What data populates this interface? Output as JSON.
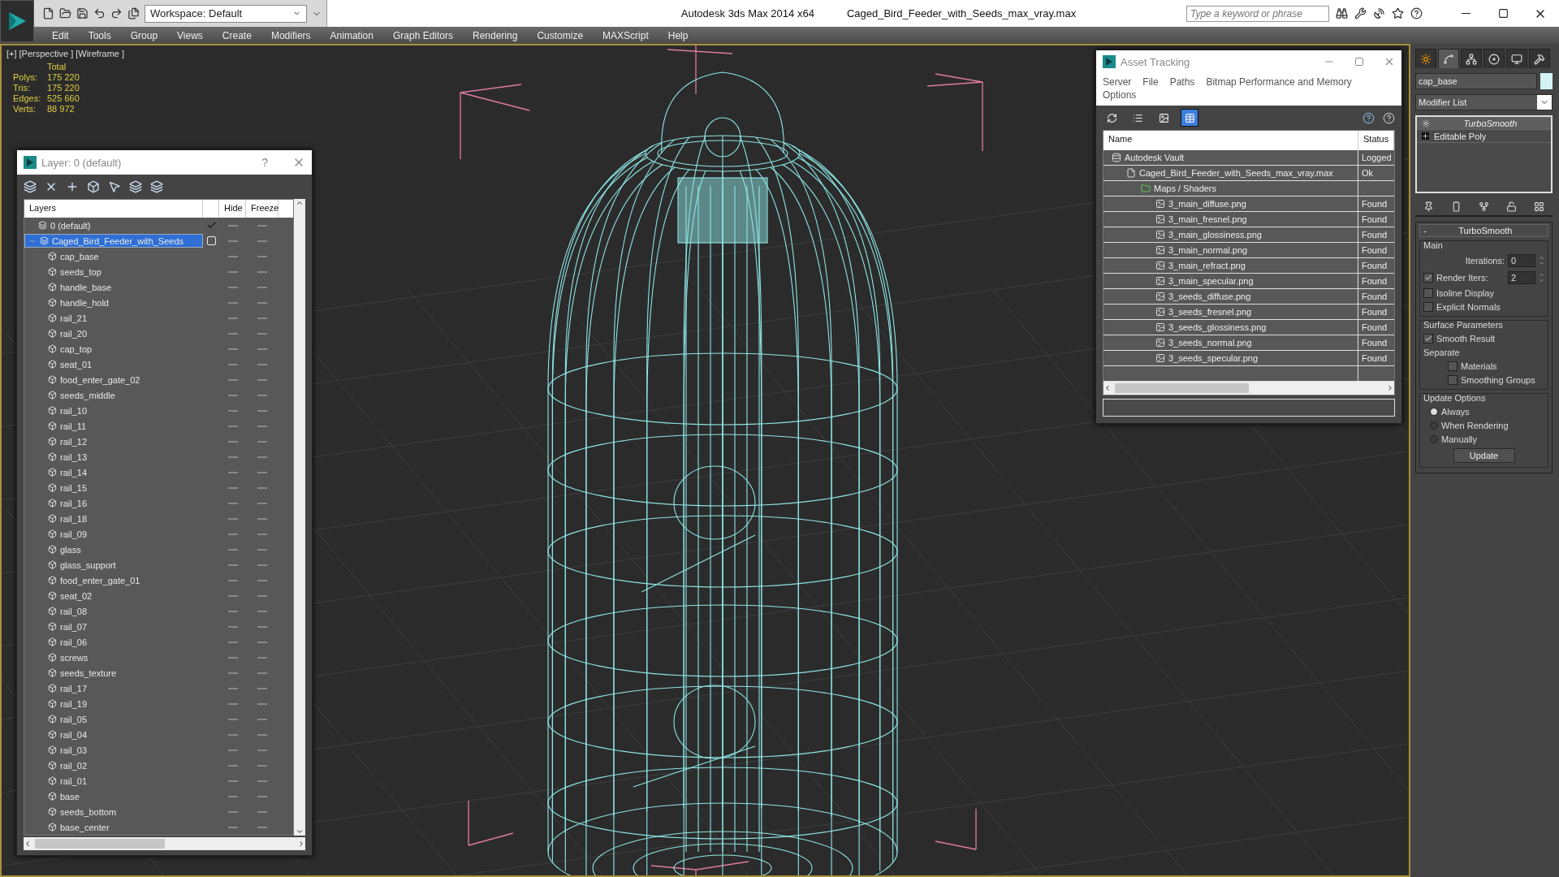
{
  "window": {
    "app_title": "Autodesk 3ds Max  2014 x64",
    "file_title": "Caged_Bird_Feeder_with_Seeds_max_vray.max",
    "workspace": "Workspace: Default",
    "search": {
      "placeholder": "Type a keyword or phrase"
    }
  },
  "menu": [
    "Edit",
    "Tools",
    "Group",
    "Views",
    "Create",
    "Modifiers",
    "Animation",
    "Graph Editors",
    "Rendering",
    "Customize",
    "MAXScript",
    "Help"
  ],
  "viewport": {
    "labels": [
      "[+]",
      "[Perspective ]",
      "[Wireframe ]"
    ],
    "stats": {
      "heading": "Total",
      "rows": [
        {
          "label": "Polys:",
          "value": "175 220"
        },
        {
          "label": "Tris:",
          "value": "175 220"
        },
        {
          "label": "Edges:",
          "value": "525 660"
        },
        {
          "label": "Verts:",
          "value": "88 972"
        }
      ]
    }
  },
  "layer_window": {
    "title": "Layer: 0 (default)",
    "help": "?",
    "columns": [
      "Layers",
      "Hide",
      "Freeze"
    ],
    "layers": [
      {
        "name": "0 (default)",
        "selected": false,
        "current": true
      },
      {
        "name": "Caged_Bird_Feeder_with_Seeds",
        "selected": true,
        "current": false,
        "children": [
          "cap_base",
          "seeds_top",
          "handle_base",
          "handle_hold",
          "rail_21",
          "rail_20",
          "cap_top",
          "seat_01",
          "food_enter_gate_02",
          "seeds_middle",
          "rail_10",
          "rail_11",
          "rail_12",
          "rail_13",
          "rail_14",
          "rail_15",
          "rail_16",
          "rail_18",
          "rail_09",
          "glass",
          "glass_support",
          "food_enter_gate_01",
          "seat_02",
          "rail_08",
          "rail_07",
          "rail_06",
          "screws",
          "seeds_texture",
          "rail_17",
          "rail_19",
          "rail_05",
          "rail_04",
          "rail_03",
          "rail_02",
          "rail_01",
          "base",
          "seeds_bottom",
          "base_center"
        ]
      }
    ]
  },
  "asset_window": {
    "title": "Asset Tracking",
    "menu": [
      "Server",
      "File",
      "Paths",
      "Bitmap Performance and Memory",
      "Options"
    ],
    "view_buttons": [
      {
        "selected": false
      },
      {
        "selected": false
      },
      {
        "selected": false
      },
      {
        "selected": true
      }
    ],
    "columns": [
      "Name",
      "Status"
    ],
    "tree": [
      {
        "kind": "vault",
        "name": "Autodesk Vault",
        "status": "Logged",
        "children": [
          {
            "kind": "file",
            "name": "Caged_Bird_Feeder_with_Seeds_max_vray.max",
            "status": "Ok",
            "children": [
              {
                "kind": "folder",
                "name": "Maps / Shaders",
                "children": [
                  {
                    "kind": "image",
                    "name": "3_main_diffuse.png",
                    "status": "Found"
                  },
                  {
                    "kind": "image",
                    "name": "3_main_fresnel.png",
                    "status": "Found"
                  },
                  {
                    "kind": "image",
                    "name": "3_main_glossiness.png",
                    "status": "Found"
                  },
                  {
                    "kind": "image",
                    "name": "3_main_normal.png",
                    "status": "Found"
                  },
                  {
                    "kind": "image",
                    "name": "3_main_refract.png",
                    "status": "Found"
                  },
                  {
                    "kind": "image",
                    "name": "3_main_specular.png",
                    "status": "Found"
                  },
                  {
                    "kind": "image",
                    "name": "3_seeds_diffuse.png",
                    "status": "Found"
                  },
                  {
                    "kind": "image",
                    "name": "3_seeds_fresnel.png",
                    "status": "Found"
                  },
                  {
                    "kind": "image",
                    "name": "3_seeds_glossiness.png",
                    "status": "Found"
                  },
                  {
                    "kind": "image",
                    "name": "3_seeds_normal.png",
                    "status": "Found"
                  },
                  {
                    "kind": "image",
                    "name": "3_seeds_specular.png",
                    "status": "Found"
                  }
                ]
              }
            ]
          }
        ]
      }
    ]
  },
  "command_panel": {
    "tabs": [
      {
        "selected": false
      },
      {
        "selected": true
      },
      {
        "selected": false
      },
      {
        "selected": false
      },
      {
        "selected": false
      },
      {
        "selected": false
      }
    ],
    "object_name": "cap_base",
    "modifier_list": "Modifier List",
    "stack": [
      {
        "name": "TurboSmooth",
        "selected": true,
        "kind": "modifier"
      },
      {
        "name": "Editable Poly",
        "selected": false,
        "kind": "object"
      }
    ],
    "rollout": {
      "title": "TurboSmooth",
      "collapse": "-",
      "main": {
        "title": "Main",
        "iterations": {
          "label": "Iterations:",
          "value": "0"
        },
        "render_iters": {
          "label": "Render Iters:",
          "value": "2",
          "checked": true
        },
        "checks": [
          {
            "label": "Isoline Display",
            "checked": false
          },
          {
            "label": "Explicit Normals",
            "checked": false
          }
        ]
      },
      "surface": {
        "title": "Surface Parameters",
        "smooth_result": {
          "label": "Smooth Result",
          "checked": true
        },
        "separate": "Separate",
        "checks": [
          {
            "label": "Materials",
            "checked": false
          },
          {
            "label": "Smoothing Groups",
            "checked": false
          }
        ]
      },
      "update": {
        "title": "Update Options",
        "options": [
          {
            "label": "Always",
            "selected": true
          },
          {
            "label": "When Rendering",
            "selected": false
          },
          {
            "label": "Manually",
            "selected": false
          }
        ],
        "button": "Update"
      }
    }
  }
}
